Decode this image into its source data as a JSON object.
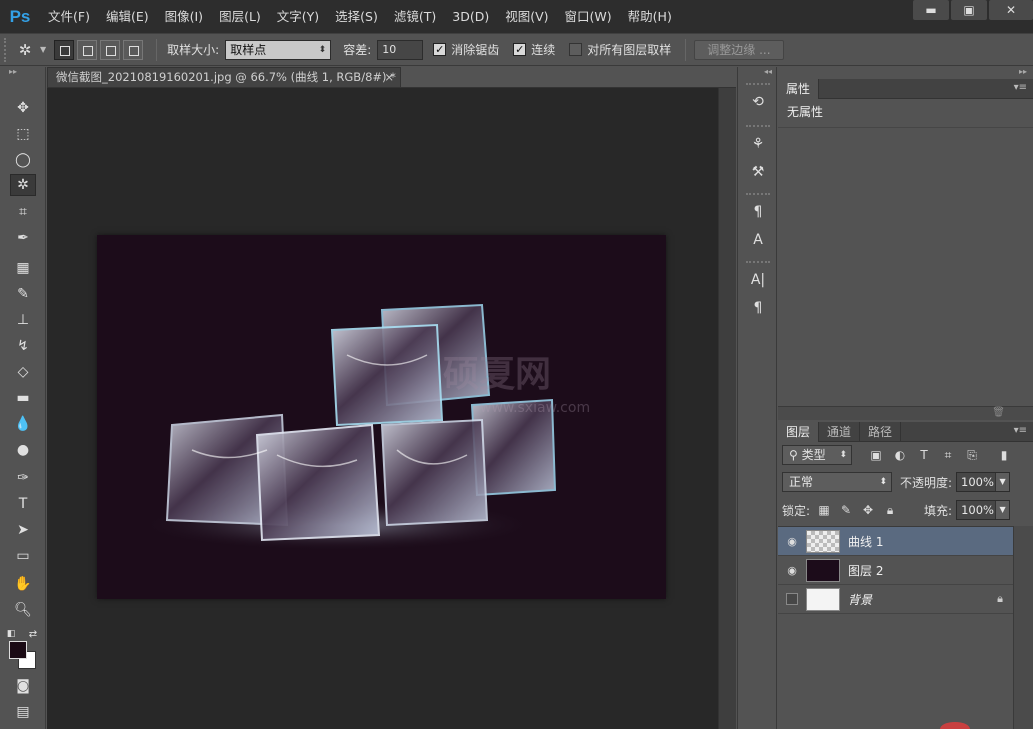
{
  "app": {
    "logo": "Ps"
  },
  "menu": [
    "文件(F)",
    "编辑(E)",
    "图像(I)",
    "图层(L)",
    "文字(Y)",
    "选择(S)",
    "滤镜(T)",
    "3D(D)",
    "视图(V)",
    "窗口(W)",
    "帮助(H)"
  ],
  "window_controls": {
    "minimize": "▬",
    "maximize": "▣",
    "close": "✕"
  },
  "options": {
    "sample_size_label": "取样大小:",
    "sample_size_value": "取样点",
    "tolerance_label": "容差:",
    "tolerance_value": "10",
    "antialias_label": "消除锯齿",
    "antialias_checked": true,
    "contiguous_label": "连续",
    "contiguous_checked": true,
    "sample_all_label": "对所有图层取样",
    "sample_all_checked": false,
    "refine_edge_label": "调整边缘 ..."
  },
  "document": {
    "tab_title": "微信截图_20210819160201.jpg @ 66.7% (曲线 1, RGB/8#) *",
    "close_glyph": "×",
    "watermark_text": "硕夏网",
    "watermark_url": "www.sxiaw.com"
  },
  "properties_panel": {
    "tab": "属性",
    "body_text": "无属性"
  },
  "layers_panel": {
    "tabs": [
      "图层",
      "通道",
      "路径"
    ],
    "filter_label": "类型",
    "blend_mode": "正常",
    "opacity_label": "不透明度:",
    "opacity_value": "100%",
    "lock_label": "锁定:",
    "fill_label": "填充:",
    "fill_value": "100%",
    "layers": [
      {
        "name": "曲线 1",
        "visible": true,
        "selected": true,
        "thumb": "transparent"
      },
      {
        "name": "图层 2",
        "visible": true,
        "selected": false,
        "thumb": "dark"
      },
      {
        "name": "背景",
        "visible": false,
        "selected": false,
        "thumb": "image",
        "locked": true
      }
    ]
  },
  "colors": {
    "foreground": "#1a0a14",
    "background": "#ffffff",
    "accent": "#33a0e6"
  }
}
